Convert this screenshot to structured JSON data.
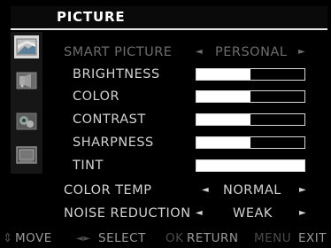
{
  "menu": {
    "title": "PICTURE",
    "sidebar_icons": [
      "picture-icon",
      "sound-icon",
      "setup-icon",
      "screen-icon"
    ]
  },
  "settings": {
    "smart_picture": {
      "label": "SMART PICTURE",
      "value": "PERSONAL",
      "left_arrow": "◄",
      "right_arrow": "►"
    },
    "brightness": {
      "label": "BRIGHTNESS",
      "level": 0.5
    },
    "color": {
      "label": "COLOR",
      "level": 0.5
    },
    "contrast": {
      "label": "CONTRAST",
      "level": 0.5
    },
    "sharpness": {
      "label": "SHARPNESS",
      "level": 0.5
    },
    "tint": {
      "label": "TINT",
      "level": 1.0
    },
    "color_temp": {
      "label": "COLOR TEMP",
      "value": "NORMAL",
      "left_arrow": "◄",
      "right_arrow": "►"
    },
    "noise_reduction": {
      "label": "NOISE REDUCTION",
      "value": "WEAK",
      "left_arrow": "◄",
      "right_arrow": "►"
    }
  },
  "footer": {
    "move_key": "⇕",
    "move_label": "MOVE",
    "select_key": "◄►",
    "select_label": "SELECT",
    "ok_key": "OK",
    "ok_label": "RETURN",
    "menu_key": "MENU",
    "menu_label": "EXIT"
  },
  "colors": {
    "background": "#000000",
    "text": "#d3d3d3",
    "dim_text": "#6d6d6d",
    "highlight": "#ffffff"
  }
}
